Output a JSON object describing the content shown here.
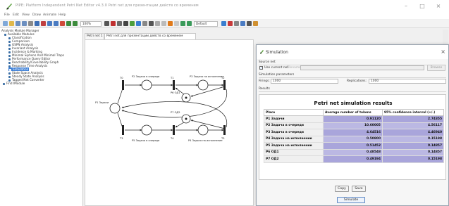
{
  "window": {
    "title": "PIPE: Platform Independent Petri Net Editor v4.3.0 Petri net для презентации действ со временем",
    "controls": {
      "minimize": "–",
      "maximize": "□",
      "close": "×"
    }
  },
  "menu": [
    "File",
    "Edit",
    "View",
    "Draw",
    "Animate",
    "Help"
  ],
  "toolbar": {
    "zoom": "100%",
    "mode": "Default"
  },
  "module_manager": {
    "root": "Analysis Module Manager",
    "group": "Available Modules",
    "items": [
      "Classification",
      "Comparison",
      "GSPN Analysis",
      "Invariant Analysis",
      "Incidence & Marking",
      "Minimal Siphons And Minimal Traps",
      "Performance Query Editor",
      "Reachability/Coverability Graph",
      "Response Time Analysis",
      "Simulation",
      "State Space Analysis",
      "Steady State Analysis",
      "Tagged Net Converter"
    ],
    "selected": "Simulation",
    "footer": "Find IModule"
  },
  "tabs": [
    "Petri net 1",
    "Petri net для презентации действ со временем"
  ],
  "net_labels": {
    "p1": "P1 Задачи",
    "p2": "P2 Задача в очереди",
    "p3": "P3 Задача на исполнение",
    "p6": "P6 ОД1",
    "p7": "P7 ОД2",
    "p5": "P5 Задача в очереди",
    "p4": "P4 Задача на исполнение",
    "t0": "T0",
    "t1": "T1",
    "t2": "T2",
    "t3": "T3",
    "t4": "T4",
    "t5": "T5",
    "t6": "T6"
  },
  "simulation": {
    "title": "Simulation",
    "source_net_label": "Source net",
    "use_current_net": "Use current net",
    "filename_label": "Filename:",
    "browse": "Browse",
    "params_label": "Simulation parameters",
    "firings_label": "Firings:",
    "firings_value": "1000",
    "replications_label": "Replications:",
    "replications_value": "1000",
    "results_label": "Results",
    "results_title": "Petri net simulation results",
    "columns": [
      "Place",
      "Average number of tokens",
      "95% confidence interval (+/-)"
    ],
    "rows": [
      {
        "place": "P1 Задачи",
        "avg": "0.91120",
        "ci": "2.74355"
      },
      {
        "place": "P2 Задача в очереди",
        "avg": "10.60005",
        "ci": "4.56117"
      },
      {
        "place": "P3 Задача в очереди",
        "avg": "4.64516",
        "ci": "4.46940"
      },
      {
        "place": "P4 Задача на исполнении",
        "avg": "0.50800",
        "ci": "0.15198"
      },
      {
        "place": "P5 Задача на исполнении",
        "avg": "0.51452",
        "ci": "0.14857"
      },
      {
        "place": "P6 ОД1",
        "avg": "0.48548",
        "ci": "0.14857"
      },
      {
        "place": "P7 ОД2",
        "avg": "0.49194",
        "ci": "0.15198"
      }
    ],
    "copy": "Copy",
    "save": "Save",
    "simulate": "Simulate"
  }
}
